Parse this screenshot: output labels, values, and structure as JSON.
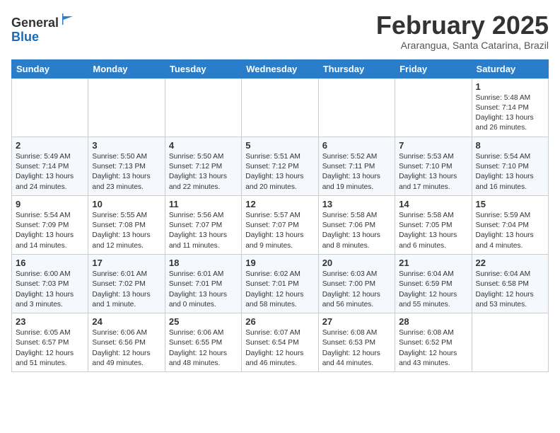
{
  "header": {
    "logo_general": "General",
    "logo_blue": "Blue",
    "month_title": "February 2025",
    "location": "Ararangua, Santa Catarina, Brazil"
  },
  "weekdays": [
    "Sunday",
    "Monday",
    "Tuesday",
    "Wednesday",
    "Thursday",
    "Friday",
    "Saturday"
  ],
  "weeks": [
    [
      {
        "day": "",
        "info": ""
      },
      {
        "day": "",
        "info": ""
      },
      {
        "day": "",
        "info": ""
      },
      {
        "day": "",
        "info": ""
      },
      {
        "day": "",
        "info": ""
      },
      {
        "day": "",
        "info": ""
      },
      {
        "day": "1",
        "info": "Sunrise: 5:48 AM\nSunset: 7:14 PM\nDaylight: 13 hours\nand 26 minutes."
      }
    ],
    [
      {
        "day": "2",
        "info": "Sunrise: 5:49 AM\nSunset: 7:14 PM\nDaylight: 13 hours\nand 24 minutes."
      },
      {
        "day": "3",
        "info": "Sunrise: 5:50 AM\nSunset: 7:13 PM\nDaylight: 13 hours\nand 23 minutes."
      },
      {
        "day": "4",
        "info": "Sunrise: 5:50 AM\nSunset: 7:12 PM\nDaylight: 13 hours\nand 22 minutes."
      },
      {
        "day": "5",
        "info": "Sunrise: 5:51 AM\nSunset: 7:12 PM\nDaylight: 13 hours\nand 20 minutes."
      },
      {
        "day": "6",
        "info": "Sunrise: 5:52 AM\nSunset: 7:11 PM\nDaylight: 13 hours\nand 19 minutes."
      },
      {
        "day": "7",
        "info": "Sunrise: 5:53 AM\nSunset: 7:10 PM\nDaylight: 13 hours\nand 17 minutes."
      },
      {
        "day": "8",
        "info": "Sunrise: 5:54 AM\nSunset: 7:10 PM\nDaylight: 13 hours\nand 16 minutes."
      }
    ],
    [
      {
        "day": "9",
        "info": "Sunrise: 5:54 AM\nSunset: 7:09 PM\nDaylight: 13 hours\nand 14 minutes."
      },
      {
        "day": "10",
        "info": "Sunrise: 5:55 AM\nSunset: 7:08 PM\nDaylight: 13 hours\nand 12 minutes."
      },
      {
        "day": "11",
        "info": "Sunrise: 5:56 AM\nSunset: 7:07 PM\nDaylight: 13 hours\nand 11 minutes."
      },
      {
        "day": "12",
        "info": "Sunrise: 5:57 AM\nSunset: 7:07 PM\nDaylight: 13 hours\nand 9 minutes."
      },
      {
        "day": "13",
        "info": "Sunrise: 5:58 AM\nSunset: 7:06 PM\nDaylight: 13 hours\nand 8 minutes."
      },
      {
        "day": "14",
        "info": "Sunrise: 5:58 AM\nSunset: 7:05 PM\nDaylight: 13 hours\nand 6 minutes."
      },
      {
        "day": "15",
        "info": "Sunrise: 5:59 AM\nSunset: 7:04 PM\nDaylight: 13 hours\nand 4 minutes."
      }
    ],
    [
      {
        "day": "16",
        "info": "Sunrise: 6:00 AM\nSunset: 7:03 PM\nDaylight: 13 hours\nand 3 minutes."
      },
      {
        "day": "17",
        "info": "Sunrise: 6:01 AM\nSunset: 7:02 PM\nDaylight: 13 hours\nand 1 minute."
      },
      {
        "day": "18",
        "info": "Sunrise: 6:01 AM\nSunset: 7:01 PM\nDaylight: 13 hours\nand 0 minutes."
      },
      {
        "day": "19",
        "info": "Sunrise: 6:02 AM\nSunset: 7:01 PM\nDaylight: 12 hours\nand 58 minutes."
      },
      {
        "day": "20",
        "info": "Sunrise: 6:03 AM\nSunset: 7:00 PM\nDaylight: 12 hours\nand 56 minutes."
      },
      {
        "day": "21",
        "info": "Sunrise: 6:04 AM\nSunset: 6:59 PM\nDaylight: 12 hours\nand 55 minutes."
      },
      {
        "day": "22",
        "info": "Sunrise: 6:04 AM\nSunset: 6:58 PM\nDaylight: 12 hours\nand 53 minutes."
      }
    ],
    [
      {
        "day": "23",
        "info": "Sunrise: 6:05 AM\nSunset: 6:57 PM\nDaylight: 12 hours\nand 51 minutes."
      },
      {
        "day": "24",
        "info": "Sunrise: 6:06 AM\nSunset: 6:56 PM\nDaylight: 12 hours\nand 49 minutes."
      },
      {
        "day": "25",
        "info": "Sunrise: 6:06 AM\nSunset: 6:55 PM\nDaylight: 12 hours\nand 48 minutes."
      },
      {
        "day": "26",
        "info": "Sunrise: 6:07 AM\nSunset: 6:54 PM\nDaylight: 12 hours\nand 46 minutes."
      },
      {
        "day": "27",
        "info": "Sunrise: 6:08 AM\nSunset: 6:53 PM\nDaylight: 12 hours\nand 44 minutes."
      },
      {
        "day": "28",
        "info": "Sunrise: 6:08 AM\nSunset: 6:52 PM\nDaylight: 12 hours\nand 43 minutes."
      },
      {
        "day": "",
        "info": ""
      }
    ]
  ]
}
